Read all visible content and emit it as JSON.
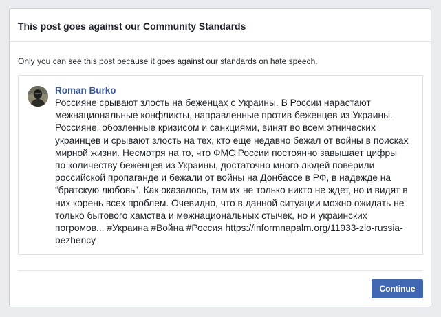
{
  "dialog": {
    "title": "This post goes against our Community Standards",
    "notice": "Only you can see this post because it goes against our standards on hate speech.",
    "continue_label": "Continue"
  },
  "post": {
    "author": "Roman Burko",
    "text": "Россияне срывают злость на беженцах с Украины. В России нарастают\nмежнациональные конфликты, направленные против беженцев из Украины.\nРоссияне, обозленные кризисом и санкциями, винят во всем этнических\nукраинцев и срывают злость на тех, кто еще недавно бежал от войны в поисках\nмирной жизни. Несмотря на то, что ФМС России постоянно завышает цифры\nпо количеству беженцев из Украины, достаточно много людей поверили\nроссийской пропаганде и бежали от войны на Донбассе в РФ, в надежде на\n“братскую любовь”. Как оказалось, там их не только никто не ждет, но и видят в\nних корень всех проблем. Очевидно, что в данной ситуации можно ожидать не\nтолько бытового хамства и межнациональных стычек, но и украинских\nпогромов... #Украина #Война #Россия https://informnapalm.org/11933-zlo-russia-\nbezhency"
  },
  "colors": {
    "accent": "#4267b2",
    "author_link": "#365899"
  }
}
